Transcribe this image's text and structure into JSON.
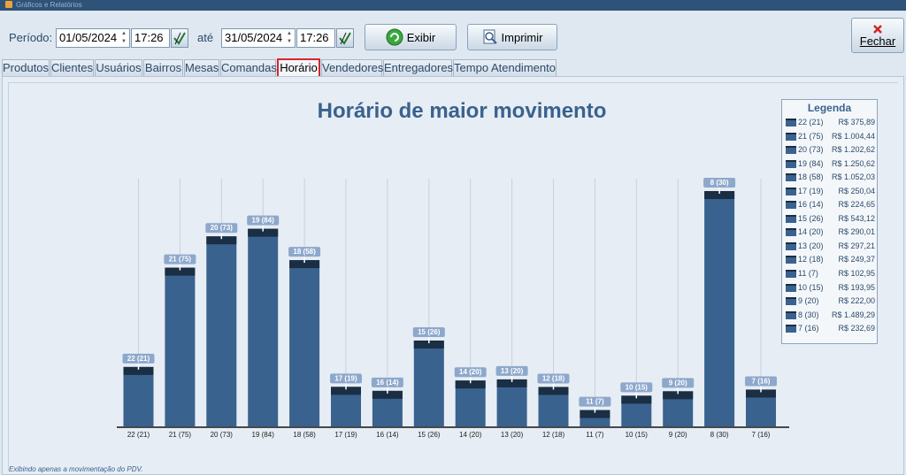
{
  "window": {
    "title": "Gráficos e Relatórios"
  },
  "toolbar": {
    "periodo_label": "Período:",
    "date_from": "01/05/2024",
    "time_from": "17:26",
    "ate_label": "até",
    "date_to": "31/05/2024",
    "time_to": "17:26",
    "exibir_label": "Exibir",
    "imprimir_label": "Imprimir",
    "fechar_label": "Fechar"
  },
  "tabs": [
    {
      "label": "Produtos"
    },
    {
      "label": "Clientes"
    },
    {
      "label": "Usuários"
    },
    {
      "label": "Bairros"
    },
    {
      "label": "Mesas"
    },
    {
      "label": "Comandas"
    },
    {
      "label": "Horário",
      "active": true
    },
    {
      "label": "Vendedores"
    },
    {
      "label": "Entregadores"
    },
    {
      "label": "Tempo Atendimento"
    }
  ],
  "footer": {
    "note": "Exibindo apenas a movimentação do PDV."
  },
  "legend": {
    "title": "Legenda",
    "items": [
      {
        "key": "22 (21)",
        "value": "R$ 375,89"
      },
      {
        "key": "21 (75)",
        "value": "R$ 1.004,44"
      },
      {
        "key": "20 (73)",
        "value": "R$ 1.202,62"
      },
      {
        "key": "19 (84)",
        "value": "R$ 1.250,62"
      },
      {
        "key": "18 (58)",
        "value": "R$ 1.052,03"
      },
      {
        "key": "17 (19)",
        "value": "R$ 250,04"
      },
      {
        "key": "16 (14)",
        "value": "R$ 224,65"
      },
      {
        "key": "15 (26)",
        "value": "R$ 543,12"
      },
      {
        "key": "14 (20)",
        "value": "R$ 290,01"
      },
      {
        "key": "13 (20)",
        "value": "R$ 297,21"
      },
      {
        "key": "12 (18)",
        "value": "R$ 249,37"
      },
      {
        "key": "11 (7)",
        "value": "R$ 102,95"
      },
      {
        "key": "10 (15)",
        "value": "R$ 193,95"
      },
      {
        "key": "9 (20)",
        "value": "R$ 222,00"
      },
      {
        "key": "8 (30)",
        "value": "R$ 1.489,29"
      },
      {
        "key": "7 (16)",
        "value": "R$ 232,69"
      }
    ]
  },
  "colors": {
    "bar": "#3a628e",
    "bar_top": "#1a2e44",
    "label_bg": "#8ea8cc",
    "grid": "#c7d2dd"
  },
  "chart_data": {
    "type": "bar",
    "title": "Horário de maior movimento",
    "categories": [
      "22 (21)",
      "21 (75)",
      "20 (73)",
      "19 (84)",
      "18 (58)",
      "17 (19)",
      "16 (14)",
      "15 (26)",
      "14 (20)",
      "13 (20)",
      "12 (18)",
      "11 (7)",
      "10 (15)",
      "9 (20)",
      "8 (30)",
      "7 (16)"
    ],
    "values": [
      375.89,
      1004.44,
      1202.62,
      1250.62,
      1052.03,
      250.04,
      224.65,
      543.12,
      290.01,
      297.21,
      249.37,
      102.95,
      193.95,
      222.0,
      1489.29,
      232.69
    ],
    "data_labels": [
      "22 (21)",
      "21 (75)",
      "20 (73)",
      "19 (84)",
      "18 (58)",
      "17 (19)",
      "16 (14)",
      "15 (26)",
      "14 (20)",
      "13 (20)",
      "12 (18)",
      "11 (7)",
      "10 (15)",
      "9 (20)",
      "8 (30)",
      "7 (16)"
    ],
    "ylim": [
      0,
      1600
    ],
    "grid": true,
    "legend_position": "right"
  }
}
